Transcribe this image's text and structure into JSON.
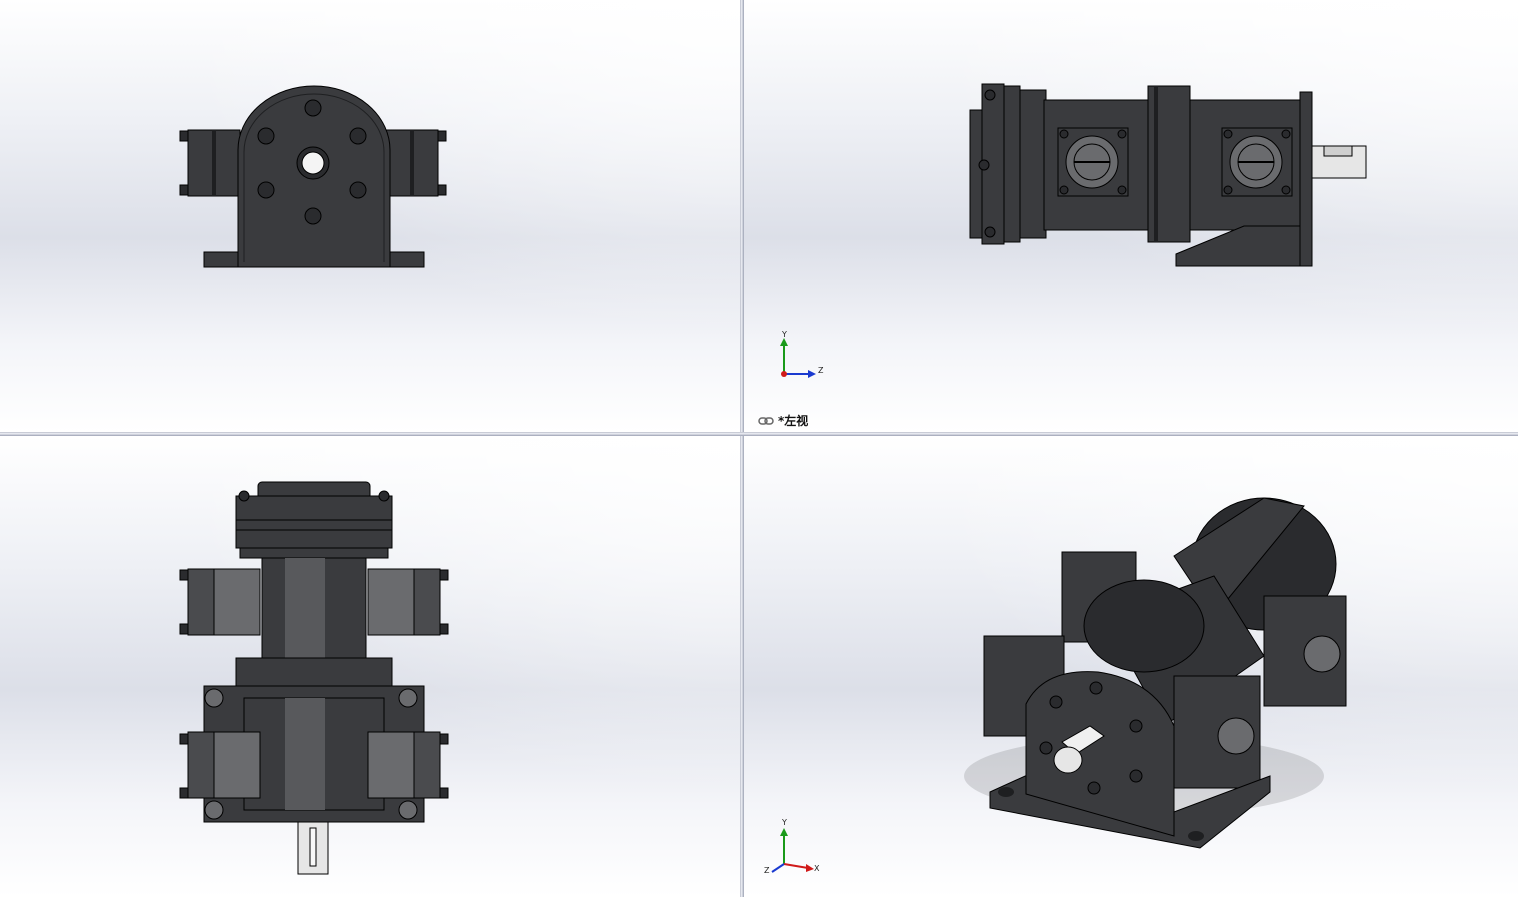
{
  "viewports": {
    "top_left": {
      "view": "front"
    },
    "top_right": {
      "view": "left",
      "label": "*左视",
      "triad": {
        "y": "Y",
        "z": "Z"
      }
    },
    "bottom_left": {
      "view": "top"
    },
    "bottom_right": {
      "view": "isometric",
      "triad": {
        "y": "Y",
        "x": "X",
        "z": "Z"
      }
    }
  },
  "colors": {
    "body": "#3a3b3e",
    "body_dark": "#1e1f21",
    "edge": "#000000",
    "port_face": "#6a6b6e",
    "shaft": "#e6e6e6",
    "axis_y": "#1a9a1a",
    "axis_z": "#1a3ad0",
    "axis_x": "#d01a1a"
  },
  "icons": {
    "view_link": "chain-link-icon"
  }
}
